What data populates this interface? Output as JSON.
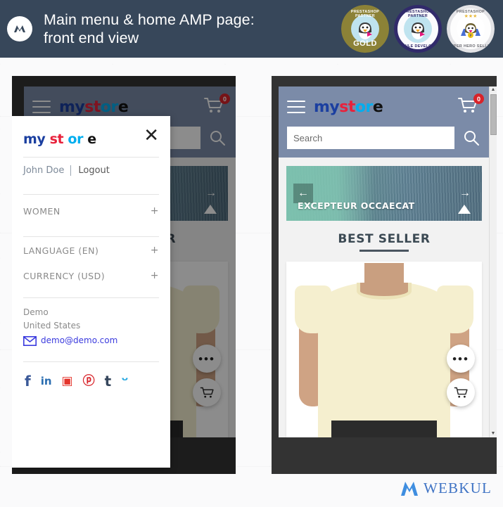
{
  "header": {
    "title": "Main menu & home AMP page: front end view",
    "logo_icon": "webkul-w-icon",
    "accent_bg": "#37475a",
    "badges": [
      {
        "name": "prestashop-partner-gold-badge",
        "top_text": "PRESTASHOP PARTNER",
        "bottom_text": "GOLD"
      },
      {
        "name": "prestashop-partner-module-developer-badge",
        "top_text": "PRESTASHOP PARTNER",
        "bottom_text": "MODULE DEVELOPER"
      },
      {
        "name": "prestashop-super-hero-seller-badge",
        "top_text": "PRESTASHOP",
        "bottom_text": "SUPER HERO SELLER"
      }
    ]
  },
  "store": {
    "logo": {
      "part1": "my",
      "part2": "st",
      "part3": "or",
      "part4": "e"
    },
    "menu_icon": "hamburger-icon",
    "cart_icon": "shopping-cart-icon",
    "cart_count": "0",
    "search_placeholder": "Search",
    "search_value": "",
    "search_icon": "search-icon"
  },
  "carousel": {
    "caption": "EXCEPTEUR OCCAECAT",
    "prev_icon": "arrow-left-icon",
    "next_icon": "arrow-right-icon",
    "indicator_icon": "triangle-up-icon"
  },
  "section": {
    "best_seller_title": "BEST SELLER"
  },
  "product": {
    "more_icon": "more-options-icon",
    "more_label": "•••",
    "cart_icon": "add-to-cart-icon"
  },
  "menu_panel": {
    "logo": {
      "part1": "my",
      "part2": "st",
      "part3": "or",
      "part4": "e"
    },
    "close_icon": "close-icon",
    "close_label": "✕",
    "user_name": "John Doe",
    "logout_label": "Logout",
    "items": [
      {
        "label": "WOMEN",
        "expander": "+"
      },
      {
        "label": "LANGUAGE (EN)",
        "expander": "+"
      },
      {
        "label": "CURRENCY (USD)",
        "expander": "+"
      }
    ],
    "contact": {
      "company": "Demo",
      "country": "United States",
      "email": "demo@demo.com",
      "email_icon": "envelope-icon"
    },
    "social": [
      {
        "name": "facebook-icon",
        "glyph": "f"
      },
      {
        "name": "linkedin-icon",
        "glyph": "in"
      },
      {
        "name": "instagram-icon",
        "glyph": "▣"
      },
      {
        "name": "pinterest-icon",
        "glyph": "ⓟ"
      },
      {
        "name": "tumblr-icon",
        "glyph": "t"
      },
      {
        "name": "twitter-icon",
        "glyph": "ᵕ"
      }
    ]
  },
  "footer": {
    "brand": "WEBKUL",
    "logo_icon": "webkul-logo-icon"
  },
  "scrollbar": {
    "up_icon": "scroll-up-icon",
    "down_icon": "scroll-down-icon"
  }
}
